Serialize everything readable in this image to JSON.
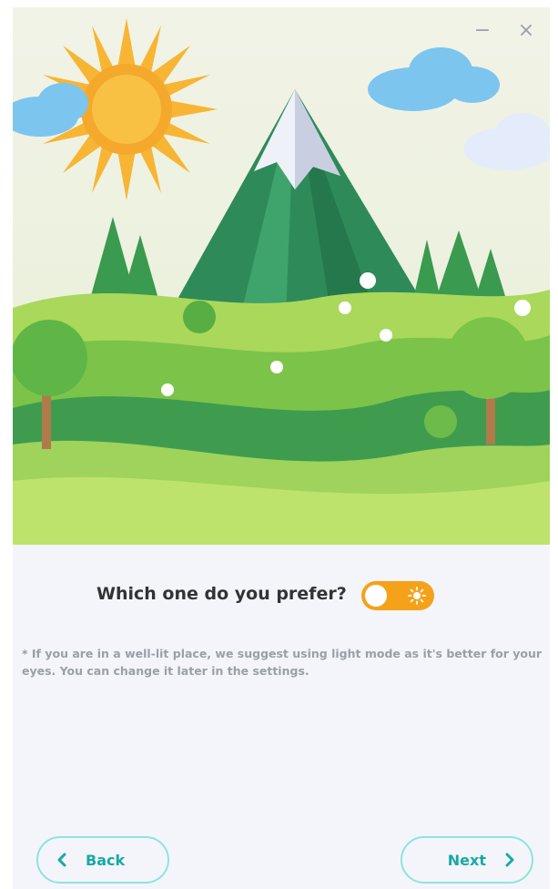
{
  "window_controls": {
    "minimize_glyph": "−",
    "close_glyph": "×"
  },
  "hero": {
    "image": "paper-craft-mountain-landscape-illustration"
  },
  "theme_prompt": {
    "question": "Which one do you prefer?",
    "toggle_state": "light",
    "toggle_icon": "sun-icon"
  },
  "note": "* If you are in a well-lit place, we suggest using light mode as it's better for your eyes. You can change it later in the settings.",
  "navigation": {
    "back_label": "Back",
    "next_label": "Next"
  },
  "colors": {
    "accent": "#17a9a6",
    "toggle_on": "#f5a21a",
    "background": "#f3f5fb"
  }
}
